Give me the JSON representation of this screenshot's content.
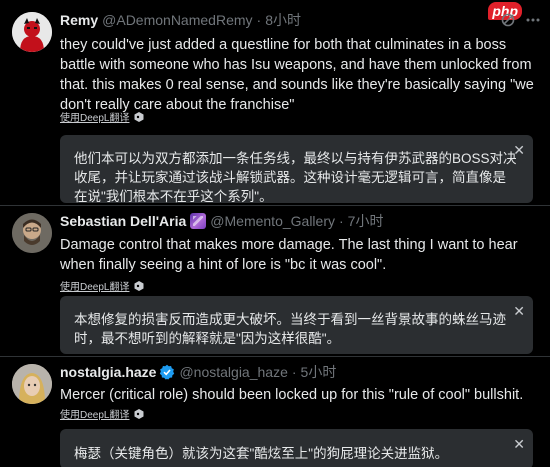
{
  "watermark": "php",
  "tweets": [
    {
      "name": "Remy",
      "handle": "@ADemonNamedRemy",
      "time": "8小时",
      "text": "they could've just added a questline for both that culminates in a boss battle with someone who has Isu weapons, and have them unlocked from that. this makes 0 real sense, and sounds like they're basically saying \"we don't really care about the franchise\"",
      "translate_label": "使用DeepL翻译",
      "translation": "他们本可以为双方都添加一条任务线，最终以与持有伊苏武器的BOSS对决收尾，并让玩家通过该战斗解锁武器。这种设计毫无逻辑可言，简直像是在说\"我们根本不在乎这个系列\"。",
      "close": "✕"
    },
    {
      "name": "Sebastian Dell'Aria",
      "handle": "@Memento_Gallery",
      "time": "7小时",
      "text": "Damage control that makes more damage. The last thing I want to hear when finally seeing a hint of lore is \"bc it was cool\".",
      "translate_label": "使用DeepL翻译",
      "translation": "本想修复的损害反而造成更大破坏。当终于看到一丝背景故事的蛛丝马迹时，最不想听到的解释就是\"因为这样很酷\"。",
      "close": "✕"
    },
    {
      "name": "nostalgia.haze",
      "handle": "@nostalgia_haze",
      "time": "5小时",
      "text": "Mercer (critical role) should been locked up for this \"rule of cool\" bullshit.",
      "translate_label": "使用DeepL翻译",
      "translation": "梅瑟（关键角色）就该为这套\"酷炫至上\"的狗屁理论关进监狱。",
      "close": "✕"
    }
  ],
  "colors": {
    "verified": "#1d9bf0",
    "muted": "#71767b",
    "box": "#2b2e31"
  },
  "icons": [
    "grok-icon",
    "more-icon",
    "deepl-icon",
    "close-icon"
  ]
}
